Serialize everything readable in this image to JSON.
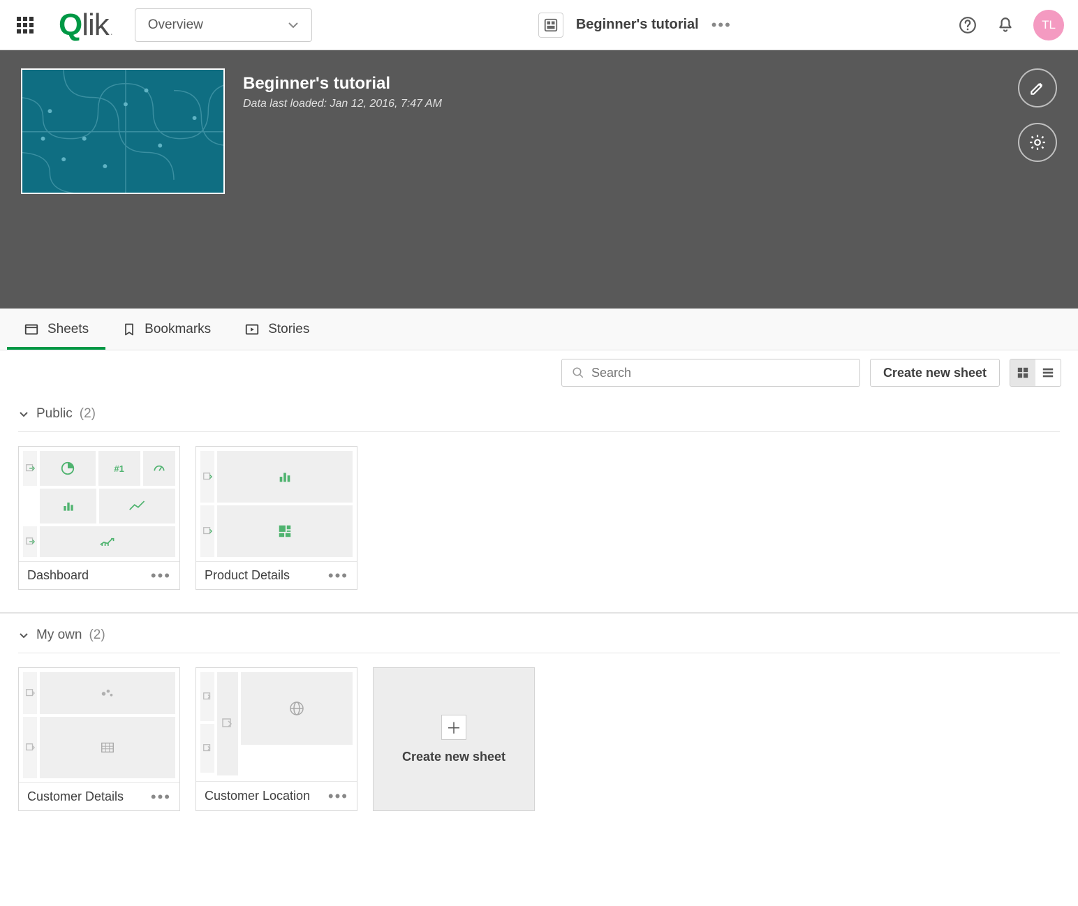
{
  "top": {
    "overview_label": "Overview",
    "app_name": "Beginner's tutorial",
    "avatar": "TL"
  },
  "hero": {
    "title": "Beginner's tutorial",
    "subtitle": "Data last loaded: Jan 12, 2016, 7:47 AM"
  },
  "tabs": {
    "sheets": "Sheets",
    "bookmarks": "Bookmarks",
    "stories": "Stories"
  },
  "toolbar": {
    "search_placeholder": "Search",
    "create_label": "Create new sheet"
  },
  "sections": {
    "public": {
      "label": "Public",
      "count": "(2)"
    },
    "myown": {
      "label": "My own",
      "count": "(2)"
    }
  },
  "cards": {
    "dashboard": "Dashboard",
    "product_details": "Product Details",
    "customer_details": "Customer Details",
    "customer_location": "Customer Location",
    "create_new": "Create new sheet"
  }
}
